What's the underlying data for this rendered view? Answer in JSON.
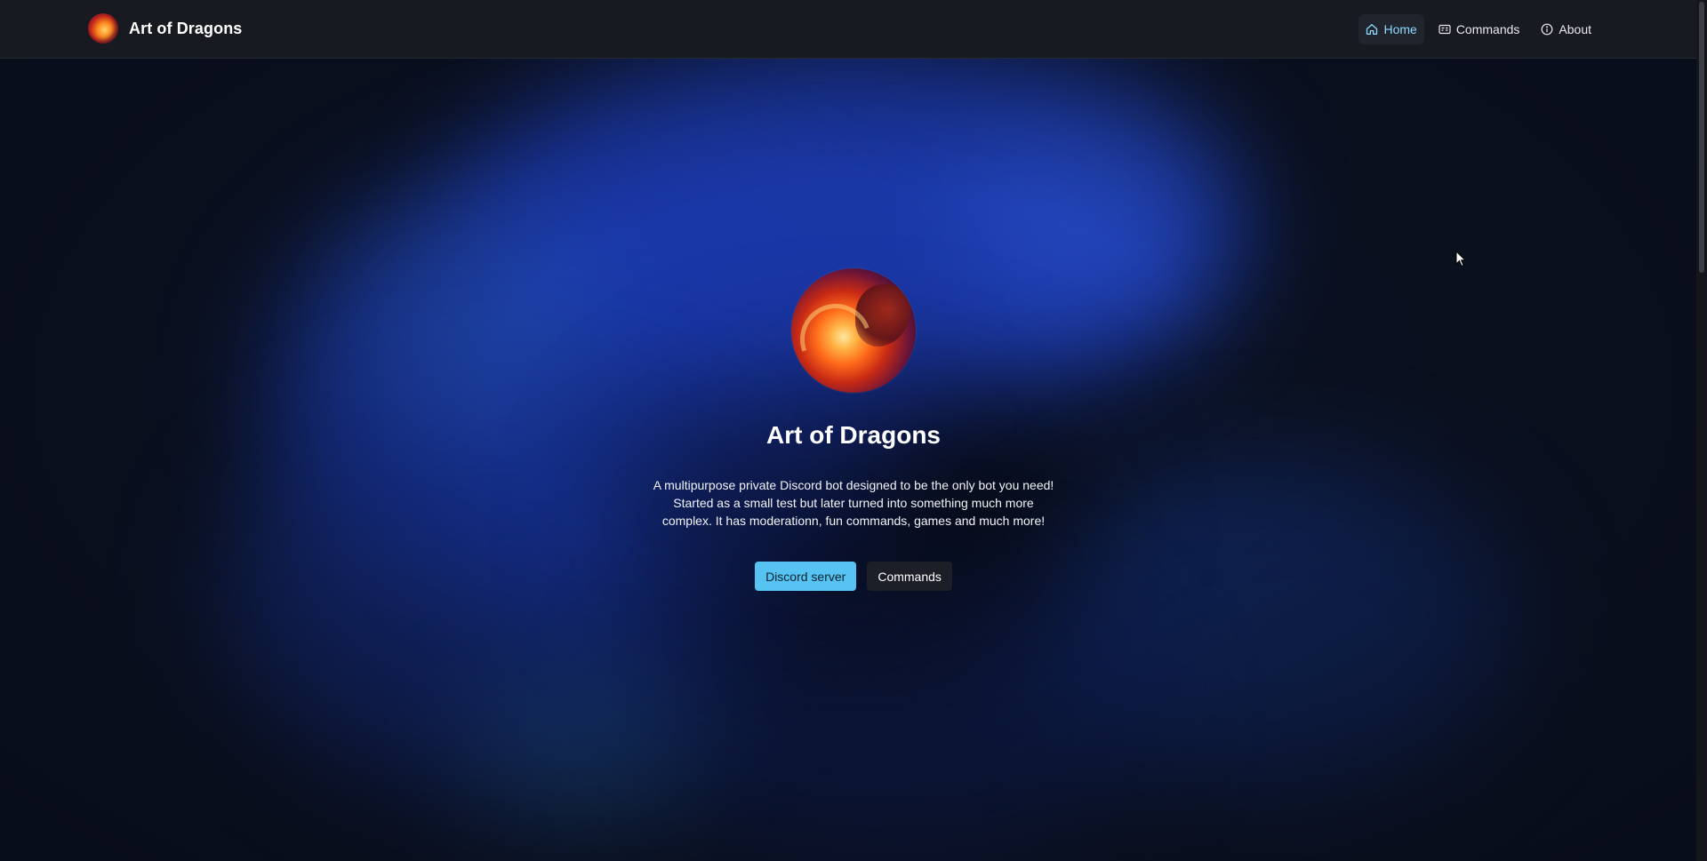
{
  "navbar": {
    "brand_name": "Art of Dragons",
    "links": [
      {
        "label": "Home",
        "icon": "home-icon",
        "active": true
      },
      {
        "label": "Commands",
        "icon": "commands-icon",
        "active": false
      },
      {
        "label": "About",
        "icon": "info-icon",
        "active": false
      }
    ]
  },
  "hero": {
    "title": "Art of Dragons",
    "description": "A multipurpose private Discord bot designed to be the only bot you need! Started as a small test but later turned into something much more complex. It has moderationn, fun commands, games and much more!",
    "primary_button": "Discord server",
    "secondary_button": "Commands"
  },
  "colors": {
    "accent": "#56c3f2",
    "active_link": "#8fd8ff",
    "navbar_bg": "#171a20",
    "background": "#0b1120"
  }
}
